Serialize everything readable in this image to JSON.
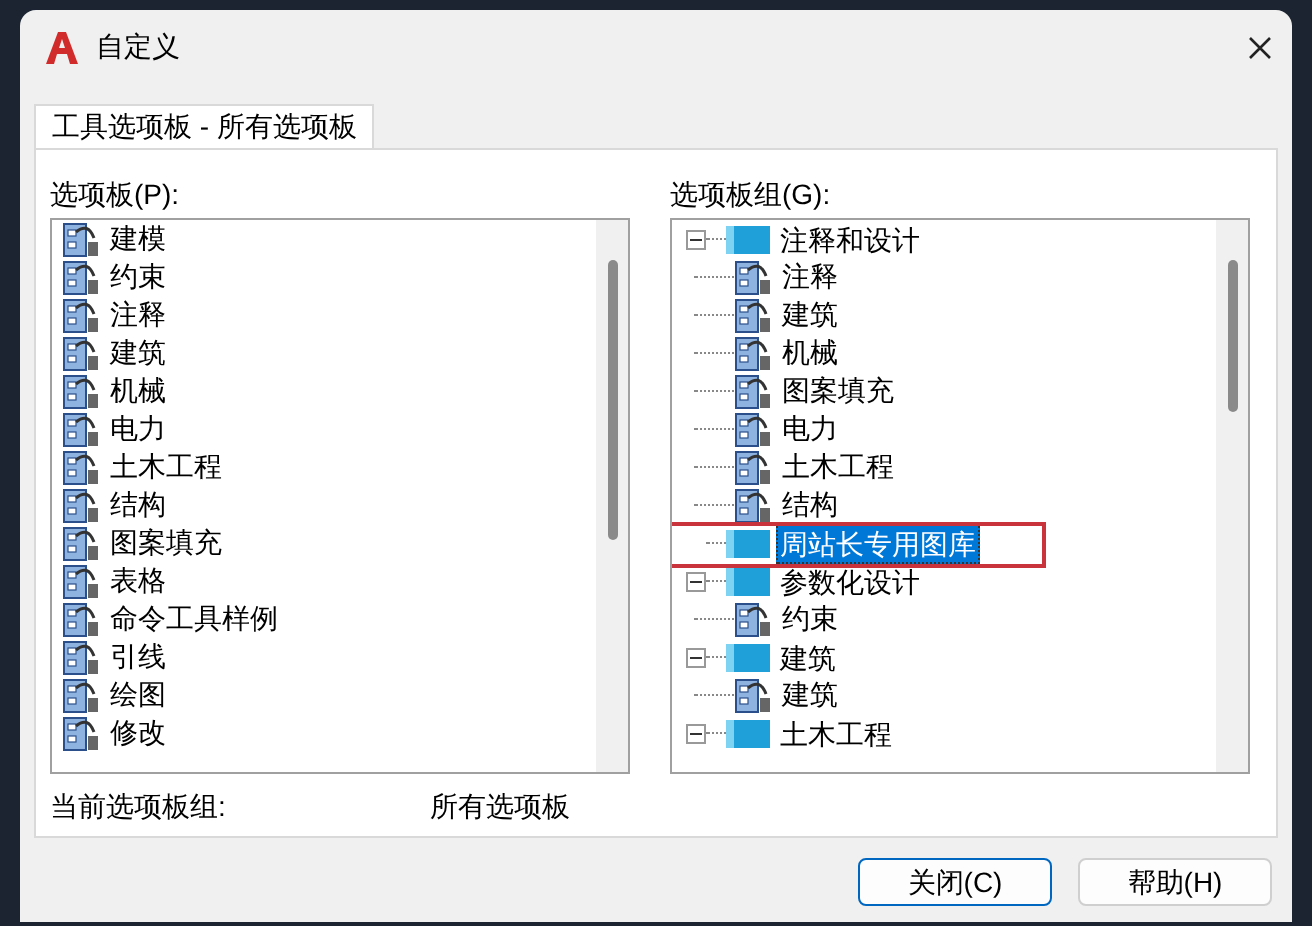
{
  "window": {
    "title": "自定义"
  },
  "tabs": [
    {
      "label": "工具选项板 - 所有选项板",
      "selected": true
    }
  ],
  "palettes": {
    "label": "选项板(P):",
    "items": [
      {
        "label": "建模"
      },
      {
        "label": "约束"
      },
      {
        "label": "注释"
      },
      {
        "label": "建筑"
      },
      {
        "label": "机械"
      },
      {
        "label": "电力"
      },
      {
        "label": "土木工程"
      },
      {
        "label": "结构"
      },
      {
        "label": "图案填充"
      },
      {
        "label": "表格"
      },
      {
        "label": "命令工具样例"
      },
      {
        "label": "引线"
      },
      {
        "label": "绘图"
      },
      {
        "label": "修改"
      }
    ]
  },
  "groups": {
    "label": "选项板组(G):",
    "items": [
      {
        "label": "注释和设计",
        "expanded": true,
        "selected": false,
        "children": [
          {
            "label": "注释",
            "selected": false
          },
          {
            "label": "建筑",
            "selected": false
          },
          {
            "label": "机械",
            "selected": false
          },
          {
            "label": "图案填充",
            "selected": false
          },
          {
            "label": "电力",
            "selected": false
          },
          {
            "label": "土木工程",
            "selected": false
          },
          {
            "label": "结构",
            "selected": false
          }
        ]
      },
      {
        "label": "周站长专用图库",
        "selected": true,
        "highlighted": true
      },
      {
        "label": "参数化设计",
        "expanded": true,
        "selected": false,
        "children": [
          {
            "label": "约束",
            "selected": false
          }
        ]
      },
      {
        "label": "建筑",
        "expanded": true,
        "selected": false,
        "children": [
          {
            "label": "建筑",
            "selected": false
          }
        ]
      },
      {
        "label": "土木工程",
        "expanded": true,
        "selected": false
      }
    ]
  },
  "current_group": {
    "label": "当前选项板组:",
    "value": "所有选项板"
  },
  "buttons": [
    "关闭(C)",
    "帮助(H)"
  ]
}
